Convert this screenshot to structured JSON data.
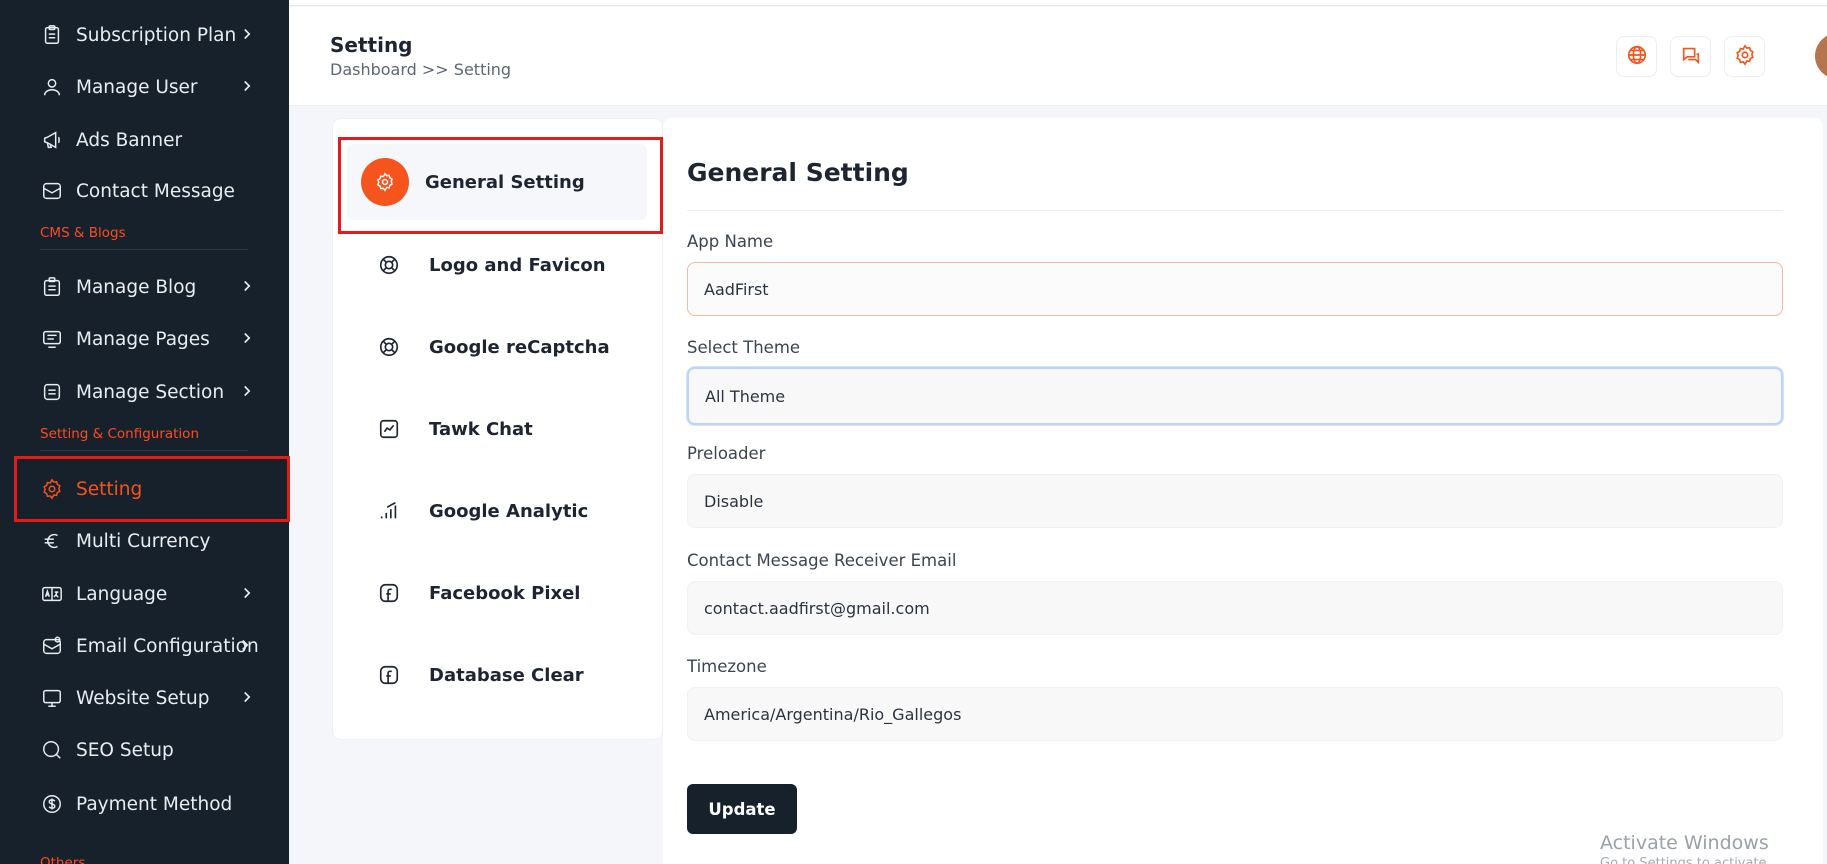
{
  "sidebar": {
    "items": [
      {
        "label": "Subscription Plan",
        "icon": "clipboard-icon",
        "chevron": true
      },
      {
        "label": "Manage User",
        "icon": "user-icon",
        "chevron": true
      },
      {
        "label": "Ads Banner",
        "icon": "megaphone-icon",
        "chevron": false
      },
      {
        "label": "Contact Message",
        "icon": "mail-icon",
        "chevron": false
      },
      {
        "label": "Manage Blog",
        "icon": "blog-icon",
        "chevron": true
      },
      {
        "label": "Manage Pages",
        "icon": "pages-icon",
        "chevron": true
      },
      {
        "label": "Manage Section",
        "icon": "section-icon",
        "chevron": true
      },
      {
        "label": "Setting",
        "icon": "gear-icon",
        "chevron": false,
        "active": true
      },
      {
        "label": "Multi Currency",
        "icon": "euro-icon",
        "chevron": false
      },
      {
        "label": "Language",
        "icon": "language-icon",
        "chevron": true
      },
      {
        "label": "Email Configuration",
        "icon": "email-config-icon",
        "chevron": true
      },
      {
        "label": "Website Setup",
        "icon": "monitor-icon",
        "chevron": true
      },
      {
        "label": "SEO Setup",
        "icon": "search-icon",
        "chevron": false
      },
      {
        "label": "Payment Method",
        "icon": "dollar-icon",
        "chevron": false
      }
    ],
    "sections": {
      "cms": "CMS & Blogs",
      "settings": "Setting & Configuration",
      "others": "Others"
    }
  },
  "header": {
    "title": "Setting",
    "breadcrumb": "Dashboard >> Setting",
    "buttons": [
      "globe-icon",
      "chat-icon",
      "gear-icon"
    ]
  },
  "settings_menu": {
    "items": [
      {
        "label": "General Setting",
        "icon": "gear-icon",
        "active": true
      },
      {
        "label": "Logo and Favicon",
        "icon": "lifebuoy-icon"
      },
      {
        "label": "Google reCaptcha",
        "icon": "lifebuoy-icon"
      },
      {
        "label": "Tawk Chat",
        "icon": "chart-line-icon"
      },
      {
        "label": "Google Analytic",
        "icon": "signal-bars-icon"
      },
      {
        "label": "Facebook Pixel",
        "icon": "facebook-icon"
      },
      {
        "label": "Database Clear",
        "icon": "facebook-icon"
      }
    ]
  },
  "form": {
    "title": "General Setting",
    "app_name_label": "App Name",
    "app_name_value": "AadFirst",
    "theme_label": "Select Theme",
    "theme_value": "All Theme",
    "preloader_label": "Preloader",
    "preloader_value": "Disable",
    "email_label": "Contact Message Receiver Email",
    "email_value": "contact.aadfirst@gmail.com",
    "timezone_label": "Timezone",
    "timezone_value": "America/Argentina/Rio_Gallegos",
    "update_label": "Update"
  },
  "watermark": {
    "line1": "Activate Windows",
    "line2": "Go to Settings to activate Windows."
  },
  "colors": {
    "accent": "#f5551d",
    "sidebar_bg": "#17212b",
    "highlight_border": "#e41b1b"
  }
}
